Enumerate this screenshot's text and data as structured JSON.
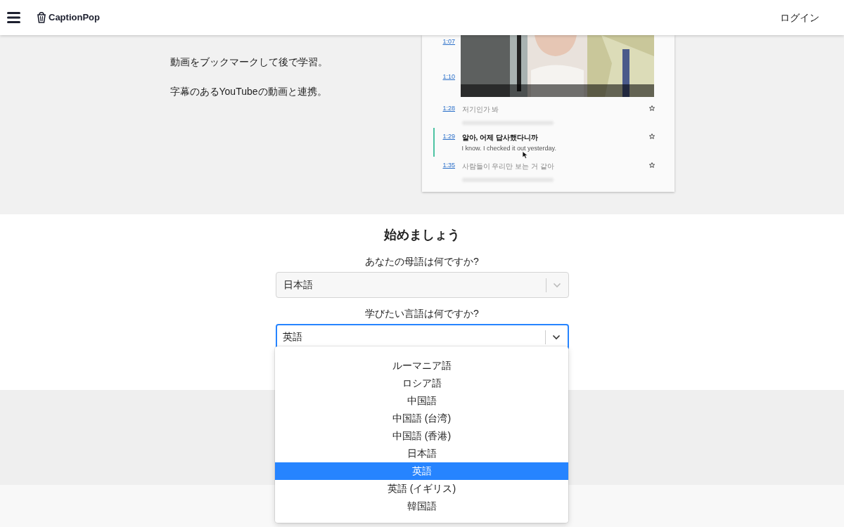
{
  "header": {
    "brand": "CaptionPop",
    "login": "ログイン"
  },
  "features": [
    "動画をブックマークして後で学習。",
    "字幕のあるYouTubeの動画と連携。"
  ],
  "preview": {
    "video_times": [
      "1:07",
      "1:10"
    ],
    "lines": [
      {
        "time": "1:28",
        "text": "저기인가 봐",
        "active": false
      },
      {
        "time": "1:29",
        "text": "알아, 어제 답사했다니까",
        "translation": "I know. I checked it out yesterday.",
        "active": true
      },
      {
        "time": "1:35",
        "text": "사람들이 우리만 보는 거 같아",
        "active": false
      }
    ]
  },
  "form": {
    "title": "始めましょう",
    "native": {
      "label": "あなたの母語は何ですか?",
      "value": "日本語",
      "focused": false
    },
    "target": {
      "label": "学びたい言語は何ですか?",
      "value": "英語",
      "focused": true
    },
    "options": [
      {
        "label": "ルーマニア語",
        "selected": false
      },
      {
        "label": "ロシア語",
        "selected": false
      },
      {
        "label": "中国語",
        "selected": false
      },
      {
        "label": "中国語 (台湾)",
        "selected": false
      },
      {
        "label": "中国語 (香港)",
        "selected": false
      },
      {
        "label": "日本語",
        "selected": false
      },
      {
        "label": "英語",
        "selected": true
      },
      {
        "label": "英語 (イギリス)",
        "selected": false
      },
      {
        "label": "韓国語",
        "selected": false
      }
    ]
  }
}
